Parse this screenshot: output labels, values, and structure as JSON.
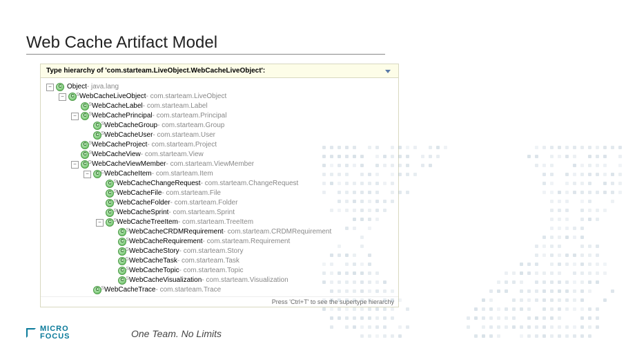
{
  "title": "Web Cache Artifact Model",
  "panel": {
    "header": "Type hierarchy of 'com.starteam.LiveObject.WebCacheLiveObject':",
    "footerHint": "Press 'Ctrl+T' to see the supertype hierarchy"
  },
  "tree": [
    {
      "depth": 0,
      "toggle": "-",
      "sup": "",
      "name": "Object",
      "pkg": "java.lang"
    },
    {
      "depth": 1,
      "toggle": "-",
      "sup": "S",
      "name": "WebCacheLiveObject",
      "pkg": "com.starteam.LiveObject"
    },
    {
      "depth": 2,
      "toggle": "",
      "sup": "S",
      "name": "WebCacheLabel",
      "pkg": "com.starteam.Label"
    },
    {
      "depth": 2,
      "toggle": "-",
      "sup": "S",
      "name": "WebCachePrincipal",
      "pkg": "com.starteam.Principal"
    },
    {
      "depth": 3,
      "toggle": "",
      "sup": "S",
      "name": "WebCacheGroup",
      "pkg": "com.starteam.Group"
    },
    {
      "depth": 3,
      "toggle": "",
      "sup": "S",
      "name": "WebCacheUser",
      "pkg": "com.starteam.User"
    },
    {
      "depth": 2,
      "toggle": "",
      "sup": "S",
      "name": "WebCacheProject",
      "pkg": "com.starteam.Project"
    },
    {
      "depth": 2,
      "toggle": "",
      "sup": "S",
      "name": "WebCacheView",
      "pkg": "com.starteam.View"
    },
    {
      "depth": 2,
      "toggle": "-",
      "sup": "G",
      "name": "WebCacheViewMember",
      "pkg": "com.starteam.ViewMember"
    },
    {
      "depth": 3,
      "toggle": "-",
      "sup": "C",
      "name": "WebCacheItem",
      "pkg": "com.starteam.Item"
    },
    {
      "depth": 4,
      "toggle": "",
      "sup": "S",
      "name": "WebCacheChangeRequest",
      "pkg": "com.starteam.ChangeRequest"
    },
    {
      "depth": 4,
      "toggle": "",
      "sup": "S",
      "name": "WebCacheFile",
      "pkg": "com.starteam.File"
    },
    {
      "depth": 4,
      "toggle": "",
      "sup": "S",
      "name": "WebCacheFolder",
      "pkg": "com.starteam.Folder"
    },
    {
      "depth": 4,
      "toggle": "",
      "sup": "S",
      "name": "WebCacheSprint",
      "pkg": "com.starteam.Sprint"
    },
    {
      "depth": 4,
      "toggle": "-",
      "sup": "S",
      "name": "WebCacheTreeItem",
      "pkg": "com.starteam.TreeItem"
    },
    {
      "depth": 5,
      "toggle": "",
      "sup": "S",
      "name": "WebCacheCRDMRequirement",
      "pkg": "com.starteam.CRDMRequirement"
    },
    {
      "depth": 5,
      "toggle": "",
      "sup": "S",
      "name": "WebCacheRequirement",
      "pkg": "com.starteam.Requirement"
    },
    {
      "depth": 5,
      "toggle": "",
      "sup": "G",
      "name": "WebCacheStory",
      "pkg": "com.starteam.Story"
    },
    {
      "depth": 5,
      "toggle": "",
      "sup": "G",
      "name": "WebCacheTask",
      "pkg": "com.starteam.Task"
    },
    {
      "depth": 5,
      "toggle": "",
      "sup": "S",
      "name": "WebCacheTopic",
      "pkg": "com.starteam.Topic"
    },
    {
      "depth": 5,
      "toggle": "",
      "sup": "S",
      "name": "WebCacheVisualization",
      "pkg": "com.starteam.Visualization"
    },
    {
      "depth": 3,
      "toggle": "",
      "sup": "S",
      "name": "WebCacheTrace",
      "pkg": "com.starteam.Trace"
    }
  ],
  "brand": {
    "line1": "MICRO",
    "line2": "FOCUS"
  },
  "tagline": "One Team. No Limits"
}
